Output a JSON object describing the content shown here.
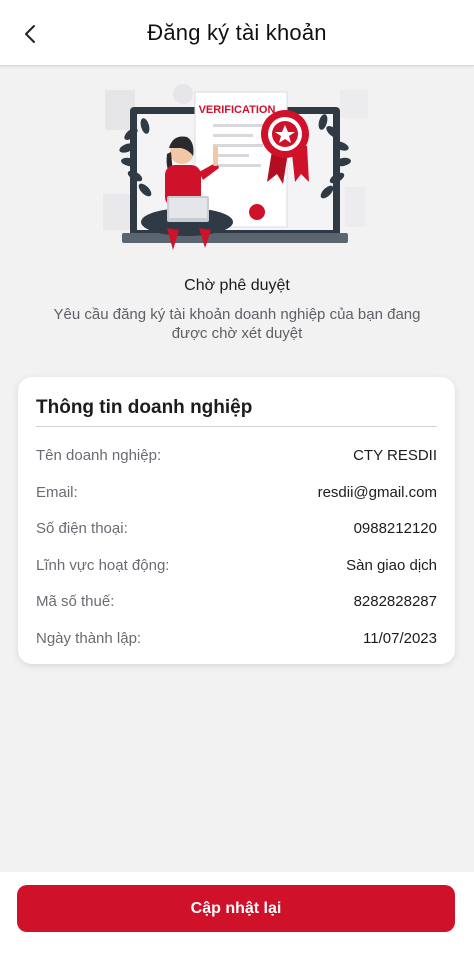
{
  "header": {
    "title": "Đăng ký tài khoản",
    "back_icon": "chevron-left-icon"
  },
  "illustration": {
    "badge_text": "VERIFICATION",
    "icon": "verification-certificate-illustration"
  },
  "status": {
    "title": "Chờ phê duyệt",
    "description": "Yêu cầu đăng ký tài khoản doanh nghiệp của bạn đang được chờ xét duyệt"
  },
  "business_info": {
    "title": "Thông tin doanh nghiệp",
    "rows": [
      {
        "label": "Tên doanh nghiệp:",
        "value": "CTY RESDII"
      },
      {
        "label": "Email:",
        "value": "resdii@gmail.com"
      },
      {
        "label": "Số điện thoại:",
        "value": "0988212120"
      },
      {
        "label": "Lĩnh vực hoạt động:",
        "value": "Sàn giao dịch"
      },
      {
        "label": "Mã số thuế:",
        "value": "8282828287"
      },
      {
        "label": "Ngày thành lập:",
        "value": "11/07/2023"
      }
    ]
  },
  "actions": {
    "update_label": "Cập nhật lại"
  },
  "colors": {
    "accent": "#d0112a",
    "background": "#f2f2f3"
  }
}
